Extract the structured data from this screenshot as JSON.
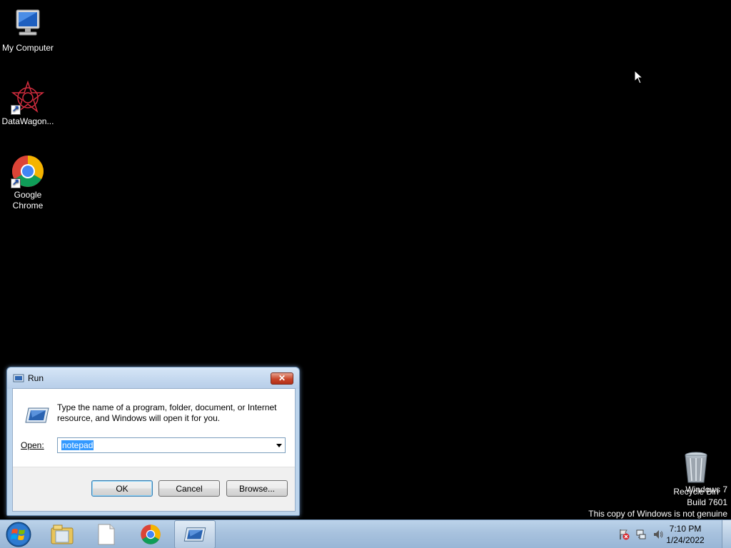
{
  "desktop": {
    "icons": [
      {
        "label": "My Computer",
        "icon": "computer-icon"
      },
      {
        "label": "DataWagon...",
        "icon": "datawagon-icon"
      },
      {
        "label": "Google Chrome",
        "icon": "chrome-icon"
      },
      {
        "label": "Recycle Bin",
        "icon": "recycle-bin-icon"
      }
    ],
    "watermark": {
      "line1": "Windows 7",
      "line2": "Build 7601",
      "line3": "This copy of Windows is not genuine"
    }
  },
  "run_dialog": {
    "title": "Run",
    "description": "Type the name of a program, folder, document, or Internet resource, and Windows will open it for you.",
    "open_label": "Open:",
    "open_value": "notepad",
    "buttons": {
      "ok": "OK",
      "cancel": "Cancel",
      "browse": "Browse..."
    }
  },
  "taskbar": {
    "items": [
      "start-orb-icon",
      "windows-explorer-icon",
      "notepad-icon",
      "chrome-icon",
      "run-icon"
    ],
    "clock": {
      "time": "7:10 PM",
      "date": "1/24/2022"
    }
  },
  "colors": {
    "desktop_bg": "#000000",
    "selection": "#3399ff",
    "taskbar": "#a8c2de",
    "close_button": "#c8452a"
  }
}
